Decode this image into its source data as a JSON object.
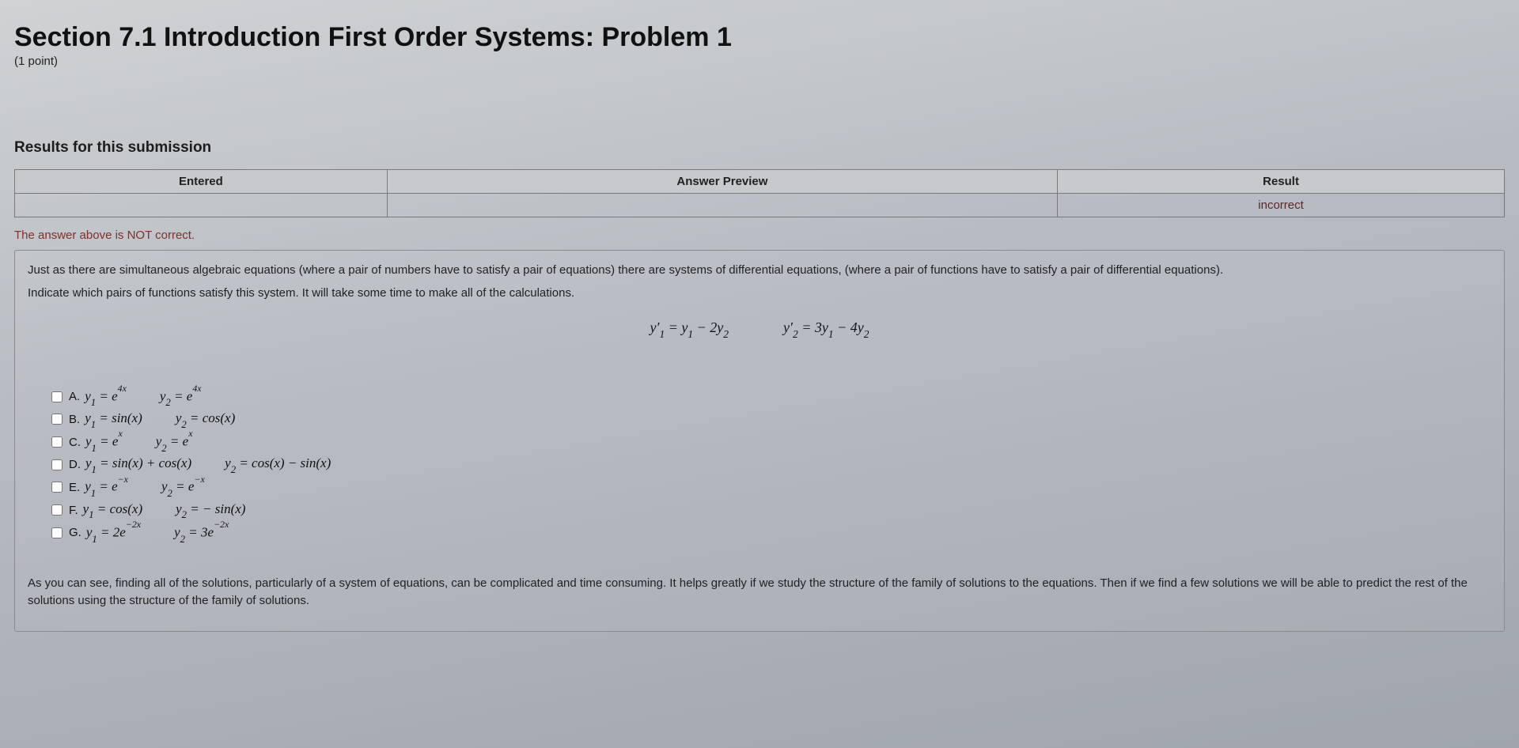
{
  "header": {
    "title": "Section 7.1 Introduction First Order Systems: Problem 1",
    "points": "(1 point)"
  },
  "results": {
    "heading": "Results for this submission",
    "columns": {
      "entered": "Entered",
      "preview": "Answer Preview",
      "result": "Result"
    },
    "row": {
      "entered": "",
      "preview": "",
      "result": "incorrect"
    },
    "not_correct": "The answer above is NOT correct."
  },
  "problem": {
    "intro1": "Just as there are simultaneous algebraic equations (where a pair of numbers have to satisfy a pair of equations) there are systems of differential equations, (where a pair of functions have to satisfy a pair of differential equations).",
    "intro2": "Indicate which pairs of functions satisfy this system. It will take some time to make all of the calculations.",
    "system": {
      "eq1": "y′₁ = y₁ − 2y₂",
      "eq2": "y′₂ = 3y₁ − 4y₂"
    },
    "options": [
      {
        "letter": "A.",
        "y1": "y₁ = e⁴ˣ",
        "y2": "y₂ = e⁴ˣ"
      },
      {
        "letter": "B.",
        "y1": "y₁ = sin(x)",
        "y2": "y₂ = cos(x)"
      },
      {
        "letter": "C.",
        "y1": "y₁ = eˣ",
        "y2": "y₂ = eˣ"
      },
      {
        "letter": "D.",
        "y1": "y₁ = sin(x) + cos(x)",
        "y2": "y₂ = cos(x) − sin(x)"
      },
      {
        "letter": "E.",
        "y1": "y₁ = e⁻ˣ",
        "y2": "y₂ = e⁻ˣ"
      },
      {
        "letter": "F.",
        "y1": "y₁ = cos(x)",
        "y2": "y₂ = − sin(x)"
      },
      {
        "letter": "G.",
        "y1": "y₁ = 2e⁻²ˣ",
        "y2": "y₂ = 3e⁻²ˣ"
      }
    ],
    "closing": "As you can see, finding all of the solutions, particularly of a system of equations, can be complicated and time consuming. It helps greatly if we study the structure of the family of solutions to the equations. Then if we find a few solutions we will be able to predict the rest of the solutions using the structure of the family of solutions."
  }
}
